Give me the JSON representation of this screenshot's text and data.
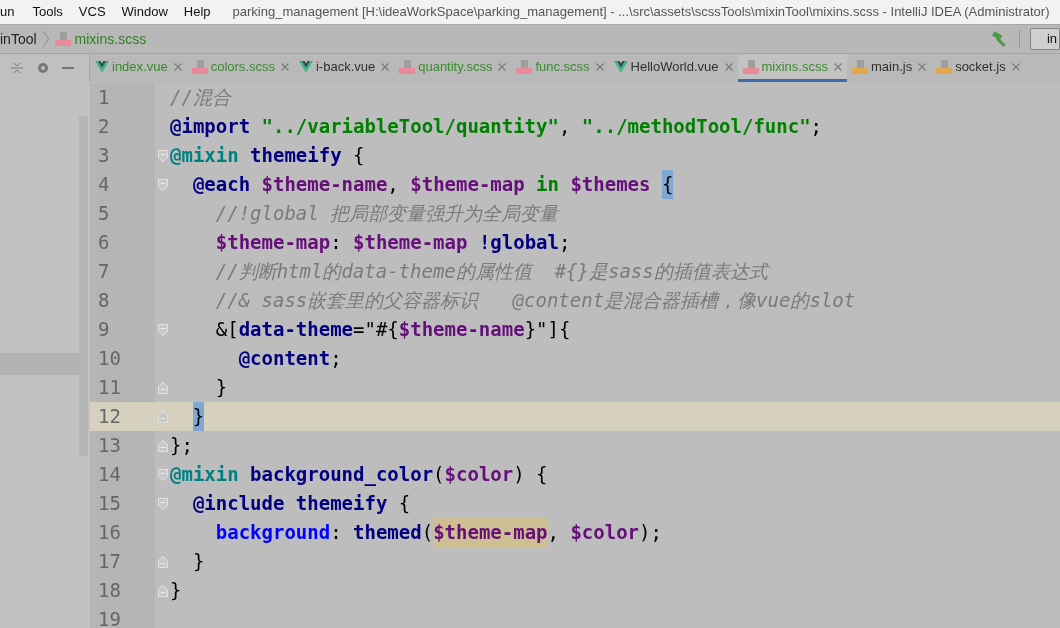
{
  "menu": [
    {
      "label": "un"
    },
    {
      "label": "Tools"
    },
    {
      "label": "VCS"
    },
    {
      "label": "Window"
    },
    {
      "label": "Help"
    }
  ],
  "window": {
    "title": "parking_management [H:\\ideaWorkSpace\\parking_management] - ...\\src\\assets\\scssTools\\mixinTool\\mixins.scss - IntelliJ IDEA (Administrator)"
  },
  "breadcrumb": [
    {
      "label": "inTool",
      "kind": "folder"
    },
    {
      "label": "mixins.scss",
      "kind": "sass"
    }
  ],
  "toolbar": {
    "config_label": "in"
  },
  "tabs": [
    {
      "label": "index.vue",
      "kind": "vue",
      "color": "#3a8a2e",
      "selected": false
    },
    {
      "label": "colors.scss",
      "kind": "sass",
      "color": "#3a8a2e",
      "selected": false
    },
    {
      "label": "i-back.vue",
      "kind": "vue",
      "color": "#303030",
      "selected": false
    },
    {
      "label": "quantity.scss",
      "kind": "sass",
      "color": "#3a8a2e",
      "selected": false
    },
    {
      "label": "func.scss",
      "kind": "sass",
      "color": "#3a8a2e",
      "selected": false
    },
    {
      "label": "HelloWorld.vue",
      "kind": "vue",
      "color": "#303030",
      "selected": false
    },
    {
      "label": "mixins.scss",
      "kind": "sass",
      "color": "#3a8a2e",
      "selected": true
    },
    {
      "label": "main.js",
      "kind": "js",
      "color": "#303030",
      "selected": false
    },
    {
      "label": "socket.js",
      "kind": "js",
      "color": "#303030",
      "selected": false
    }
  ],
  "editor": {
    "lines": [
      {
        "number": "1",
        "current": false,
        "tokens": [
          {
            "kind": "comment",
            "text": "//混合"
          }
        ]
      },
      {
        "number": "2",
        "current": false,
        "tokens": [
          {
            "kind": "directive",
            "text": "@import "
          },
          {
            "kind": "string",
            "text": "\"../variableTool/quantity\""
          },
          {
            "kind": "plain",
            "text": ", "
          },
          {
            "kind": "string",
            "text": "\"../methodTool/func\""
          },
          {
            "kind": "plain",
            "text": ";"
          }
        ]
      },
      {
        "number": "3",
        "current": false,
        "fold_open": true,
        "tokens": [
          {
            "kind": "mixin",
            "text": "@mixin "
          },
          {
            "kind": "name",
            "text": "themeify"
          },
          {
            "kind": "plain",
            "text": " {"
          }
        ]
      },
      {
        "number": "4",
        "current": false,
        "fold_open": true,
        "tokens": [
          {
            "kind": "directive",
            "text": "  @each "
          },
          {
            "kind": "variable",
            "text": "$theme-name"
          },
          {
            "kind": "plain",
            "text": ", "
          },
          {
            "kind": "variable",
            "text": "$theme-map "
          },
          {
            "kind": "keyword",
            "text": "in "
          },
          {
            "kind": "variable",
            "text": "$themes "
          },
          {
            "kind": "plain",
            "text": "{",
            "brace_match": true
          }
        ]
      },
      {
        "number": "5",
        "current": false,
        "tokens": [
          {
            "kind": "comment",
            "text": "    //!global 把局部变量强升为全局变量"
          }
        ]
      },
      {
        "number": "6",
        "current": false,
        "tokens": [
          {
            "kind": "variable",
            "text": "    $theme-map"
          },
          {
            "kind": "plain",
            "text": ": "
          },
          {
            "kind": "variable",
            "text": "$theme-map "
          },
          {
            "kind": "name",
            "text": "!global"
          },
          {
            "kind": "plain",
            "text": ";"
          }
        ]
      },
      {
        "number": "7",
        "current": false,
        "tokens": [
          {
            "kind": "comment",
            "text": "    //判断html的data-theme的属性值  #{}是sass的插值表达式"
          }
        ]
      },
      {
        "number": "8",
        "current": false,
        "tokens": [
          {
            "kind": "comment",
            "text": "    //& sass嵌套里的父容器标识   @content是混合器插槽，像vue的slot"
          }
        ]
      },
      {
        "number": "9",
        "current": false,
        "fold_open": true,
        "tokens": [
          {
            "kind": "plain",
            "text": "    &["
          },
          {
            "kind": "name",
            "text": "data-theme"
          },
          {
            "kind": "plain",
            "text": "=\"#{"
          },
          {
            "kind": "variable",
            "text": "$theme-name"
          },
          {
            "kind": "plain",
            "text": "}\"]{"
          }
        ]
      },
      {
        "number": "10",
        "current": false,
        "tokens": [
          {
            "kind": "directive",
            "text": "      @content"
          },
          {
            "kind": "plain",
            "text": ";"
          }
        ]
      },
      {
        "number": "11",
        "current": false,
        "fold_close": true,
        "tokens": [
          {
            "kind": "plain",
            "text": "    }"
          }
        ]
      },
      {
        "number": "12",
        "current": true,
        "fold_close": true,
        "tokens": [
          {
            "kind": "plain",
            "text": "  }",
            "brace_match": true
          }
        ]
      },
      {
        "number": "13",
        "current": false,
        "fold_close": true,
        "tokens": [
          {
            "kind": "plain",
            "text": "};"
          }
        ]
      },
      {
        "number": "14",
        "current": false,
        "fold_open": true,
        "tokens": [
          {
            "kind": "mixin",
            "text": "@mixin "
          },
          {
            "kind": "name",
            "text": "background_color"
          },
          {
            "kind": "plain",
            "text": "("
          },
          {
            "kind": "variable",
            "text": "$color"
          },
          {
            "kind": "plain",
            "text": ") {"
          }
        ]
      },
      {
        "number": "15",
        "current": false,
        "fold_open": true,
        "tokens": [
          {
            "kind": "directive",
            "text": "  @include "
          },
          {
            "kind": "name",
            "text": "themeify"
          },
          {
            "kind": "plain",
            "text": " {"
          }
        ]
      },
      {
        "number": "16",
        "current": false,
        "tokens": [
          {
            "kind": "property",
            "text": "    background"
          },
          {
            "kind": "plain",
            "text": ": "
          },
          {
            "kind": "name",
            "text": "themed"
          },
          {
            "kind": "plain",
            "text": "("
          },
          {
            "kind": "variable",
            "text": "$theme-map",
            "usage_highlight": true
          },
          {
            "kind": "plain",
            "text": ", "
          },
          {
            "kind": "variable",
            "text": "$color"
          },
          {
            "kind": "plain",
            "text": ");"
          }
        ]
      },
      {
        "number": "17",
        "current": false,
        "fold_close": true,
        "tokens": [
          {
            "kind": "plain",
            "text": "  }"
          }
        ]
      },
      {
        "number": "18",
        "current": false,
        "fold_close": true,
        "tokens": [
          {
            "kind": "plain",
            "text": "}"
          }
        ]
      },
      {
        "number": "19",
        "current": false
      }
    ]
  }
}
